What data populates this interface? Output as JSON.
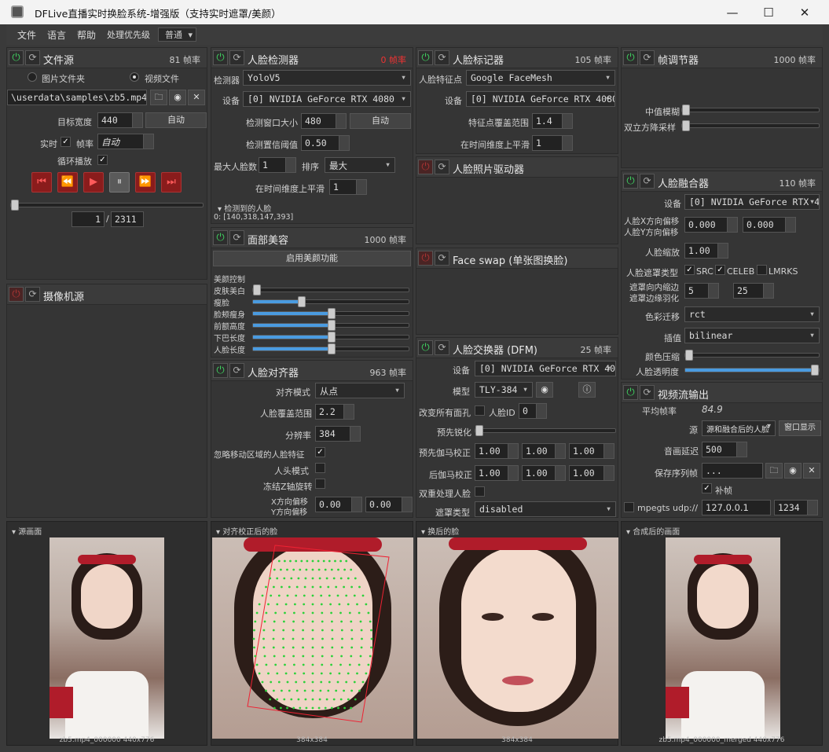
{
  "window": {
    "title": "DFLive直播实时换脸系统-增强版（支持实时遮罩/美颜）",
    "minimize": "—",
    "maximize": "☐",
    "close": "✕"
  },
  "menu": {
    "file": "文件",
    "language": "语言",
    "help": "帮助",
    "priority_label": "处理优先级",
    "priority_value": "普通"
  },
  "file_source": {
    "title": "文件源",
    "fps": "81 帧率",
    "image_folder": "图片文件夹",
    "video_file": "视频文件",
    "path": "\\userdata\\samples\\zb5.mp4",
    "target_width_label": "目标宽度",
    "target_width": "440",
    "auto": "自动",
    "realtime": "实时",
    "fps_label": "帧率",
    "fps_value": "自动",
    "loop": "循环播放",
    "frame_current": "1",
    "frame_total": "2311"
  },
  "camera": {
    "title": "摄像机源"
  },
  "detector": {
    "title": "人脸检测器",
    "fps": "0 帧率",
    "detector_label": "检测器",
    "detector_value": "YoloV5",
    "device_label": "设备",
    "device_value": "[0] NVIDIA GeForce RTX 4080",
    "window_label": "检测窗口大小",
    "window_value": "480",
    "auto": "自动",
    "threshold_label": "检测置信阈值",
    "threshold_value": "0.50",
    "max_faces_label": "最大人脸数",
    "max_faces_value": "1",
    "sort_label": "排序",
    "sort_value": "最大",
    "smooth_label": "在时间维度上平滑",
    "smooth_value": "1",
    "detected_label": "检测到的人脸",
    "detected_value": "0: [140,318,147,393]"
  },
  "beauty": {
    "title": "面部美容",
    "fps": "1000 帧率",
    "enable": "启用美颜功能",
    "control": "美颜控制",
    "items": [
      {
        "label": "皮肤美白",
        "value": 0.0
      },
      {
        "label": "瘦脸",
        "value": 0.3
      },
      {
        "label": "脸颊瘦身",
        "value": 0.5
      },
      {
        "label": "前额高度",
        "value": 0.5
      },
      {
        "label": "下巴长度",
        "value": 0.5
      },
      {
        "label": "人脸长度",
        "value": 0.5
      }
    ]
  },
  "aligner": {
    "title": "人脸对齐器",
    "fps": "963 帧率",
    "mode_label": "对齐模式",
    "mode_value": "从点",
    "coverage_label": "人脸覆盖范围",
    "coverage_value": "2.2",
    "resolution_label": "分辨率",
    "resolution_value": "384",
    "ignore_label": "忽略移动区域的人脸特征",
    "head_mode_label": "人头模式",
    "freeze_label": "冻结Z轴旋转",
    "x_offset_label": "X方向偏移",
    "y_offset_label": "Y方向偏移",
    "x_offset": "0.00",
    "y_offset": "0.00"
  },
  "marker": {
    "title": "人脸标记器",
    "fps": "105 帧率",
    "landmark_label": "人脸特征点",
    "landmark_value": "Google FaceMesh",
    "device_label": "设备",
    "device_value": "[0] NVIDIA GeForce RTX 4080",
    "range_label": "特征点覆盖范围",
    "range_value": "1.4",
    "smooth_label": "在时间维度上平滑",
    "smooth_value": "1"
  },
  "photo_driver": {
    "title": "人脸照片驱动器"
  },
  "face_swap_single": {
    "title": "Face swap (单张图换脸)"
  },
  "dfm": {
    "title": "人脸交换器 (DFM)",
    "fps": "25 帧率",
    "device_label": "设备",
    "device_value": "[0] NVIDIA GeForce RTX 4080",
    "model_label": "模型",
    "model_value": "TLY-384",
    "swap_all_label": "改变所有面孔",
    "face_id_label": "人脸ID",
    "face_id_value": "0",
    "presharpen_label": "预先锐化",
    "pre_gamma_label": "预先伽马校正",
    "post_gamma_label": "后伽马校正",
    "gamma": [
      "1.00",
      "1.00",
      "1.00"
    ],
    "post_gamma": [
      "1.00",
      "1.00",
      "1.00"
    ],
    "two_pass_label": "双重处理人脸",
    "mask_label": "遮罩类型",
    "mask_value": "disabled",
    "info_icon": "ⓘ"
  },
  "frame_adj": {
    "title": "帧调节器",
    "fps": "1000 帧率",
    "median_label": "中值模糊",
    "bilateral_label": "双立方降采样"
  },
  "merger": {
    "title": "人脸融合器",
    "fps": "110 帧率",
    "device_label": "设备",
    "device_value": "[0] NVIDIA GeForce RTX 4080",
    "x_offset_label": "人脸X方向偏移",
    "y_offset_label": "人脸Y方向偏移",
    "x_offset": "0.000",
    "y_offset": "0.000",
    "scale_label": "人脸缩放",
    "scale_value": "1.00",
    "mask_type_label": "人脸遮罩类型",
    "src": "SRC",
    "celeb": "CELEB",
    "lmrks": "LMRKS",
    "erode_label": "遮罩向内缩边",
    "blur_label": "遮罩边缘羽化",
    "erode_value": "5",
    "blur_value": "25",
    "color_label": "色彩迁移",
    "color_value": "rct",
    "interp_label": "插值",
    "interp_value": "bilinear",
    "compress_label": "颜色压缩",
    "opacity_label": "人脸透明度"
  },
  "stream": {
    "title": "视频流输出",
    "avg_fps_label": "平均帧率",
    "avg_fps_value": "84.9",
    "source_label": "源",
    "source_value": "源和融合后的人脸",
    "window_btn": "窗口显示",
    "delay_label": "音画延迟",
    "delay_value": "500",
    "save_label": "保存序列帧",
    "save_value": "...",
    "fill_label": "补帧",
    "mpeg_label": "mpegts udp://",
    "ip": "127.0.0.1",
    "port": "1234"
  },
  "views": {
    "source": {
      "title": "源画面",
      "caption": "zb5.mp4_000000 440x776"
    },
    "aligned": {
      "title": "对齐校正后的脸",
      "caption": "384x384"
    },
    "swapped": {
      "title": "换后的脸",
      "caption": "384x384"
    },
    "merged": {
      "title": "合成后的画面",
      "caption": "zb5.mp4_000000_merged 440x776"
    }
  },
  "icons": {
    "power": "⏻",
    "reload": "⟳",
    "folder": "🗀",
    "eye": "◉",
    "close": "✕",
    "check": "✓"
  }
}
